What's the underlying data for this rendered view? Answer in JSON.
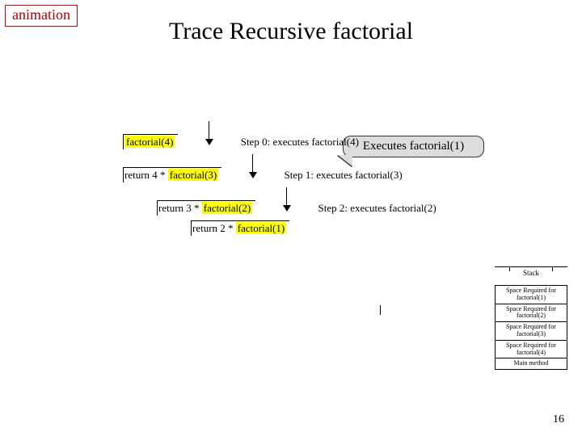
{
  "badge": "animation",
  "title": "Trace Recursive factorial",
  "page_number": "16",
  "callout": "Executes factorial(1)",
  "trace": {
    "calls": [
      {
        "indent": 0,
        "prefix": "",
        "highlight": "factorial(4)"
      },
      {
        "indent": 1,
        "prefix": "return 4 * ",
        "highlight": "factorial(3)"
      },
      {
        "indent": 2,
        "prefix": "return 3 * ",
        "highlight": "factorial(2)"
      },
      {
        "indent": 3,
        "prefix": "return 2 * ",
        "highlight": "factorial(1)"
      }
    ],
    "steps": [
      "Step 0: executes factorial(4)",
      "Step 1: executes factorial(3)",
      "Step 2: executes factorial(2)"
    ]
  },
  "stack": {
    "title": "Stack",
    "frames": [
      "Space Required for factorial(1)",
      "Space Required for factorial(2)",
      "Space Required for factorial(3)",
      "Space Required for factorial(4)",
      "Main method"
    ]
  }
}
